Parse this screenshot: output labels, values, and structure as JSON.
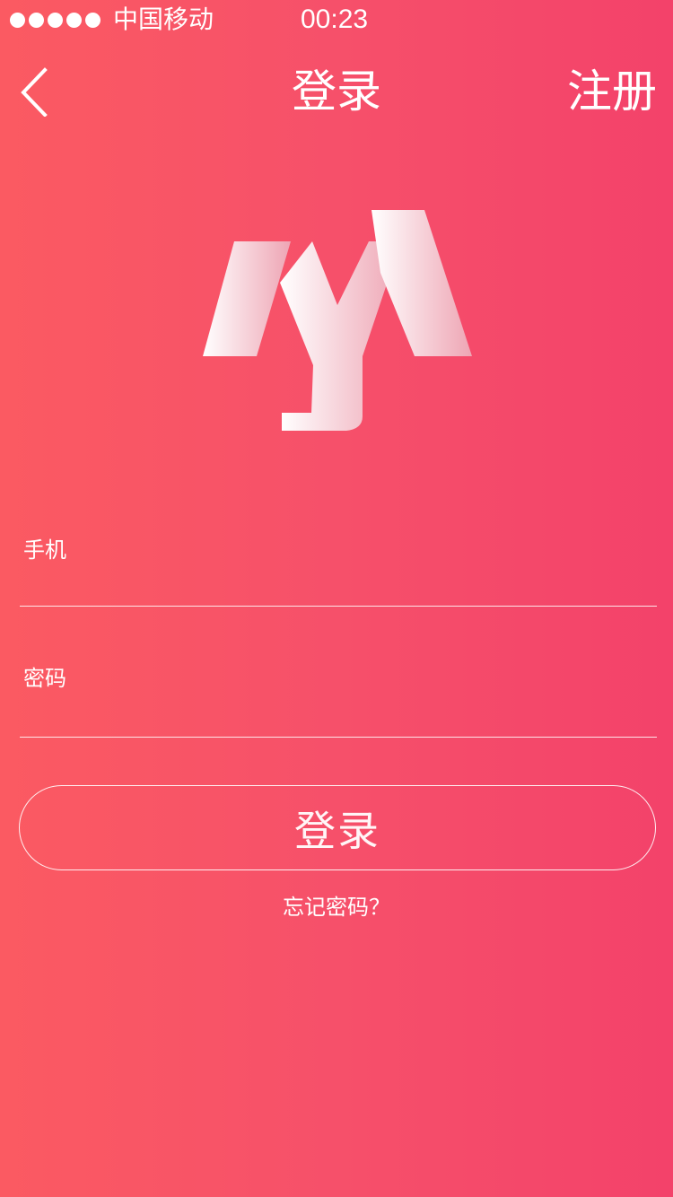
{
  "status_bar": {
    "signal_dots": 5,
    "carrier": "中国移动",
    "time": "00:23"
  },
  "nav": {
    "back_icon": "chevron-left-icon",
    "title": "登录",
    "register_label": "注册"
  },
  "logo": {
    "name": "brand-logo",
    "gradient_start": "#ffffff",
    "gradient_end": "#eea5b4"
  },
  "form": {
    "phone_label": "手机",
    "phone_value": "",
    "password_label": "密码",
    "password_value": "",
    "login_label": "登录",
    "forgot_label": "忘记密码？"
  },
  "colors": {
    "background_left": "#fb5a62",
    "background_right": "#f3426a",
    "text": "#ffffff"
  }
}
